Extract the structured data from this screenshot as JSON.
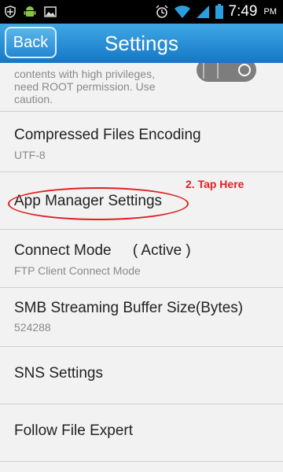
{
  "status_bar": {
    "time": "7:49",
    "ampm": "PM",
    "icons": [
      "shield-icon",
      "android-icon",
      "image-icon",
      "alarm-icon",
      "wifi-icon",
      "signal-icon",
      "battery-icon"
    ]
  },
  "header": {
    "back_label": "Back",
    "title": "Settings"
  },
  "settings": {
    "partial_item": {
      "text_line1": "contents with high privileges,",
      "text_line2": "need ROOT permission. Use",
      "text_line3": "caution."
    },
    "items": [
      {
        "title": "Compressed Files Encoding",
        "subtitle": "UTF-8"
      },
      {
        "title": "App Manager Settings",
        "subtitle": ""
      },
      {
        "title": "Connect Mode",
        "status": "( Active )",
        "subtitle": "FTP Client Connect Mode"
      },
      {
        "title": "SMB Streaming Buffer Size(Bytes)",
        "subtitle": "524288"
      },
      {
        "title": "SNS Settings",
        "subtitle": ""
      },
      {
        "title": "Follow File Expert",
        "subtitle": ""
      }
    ]
  },
  "annotation": {
    "text": "2. Tap Here",
    "color": "#e02020"
  },
  "colors": {
    "titlebar": "#1e86d4",
    "background": "#f2f2f2"
  }
}
